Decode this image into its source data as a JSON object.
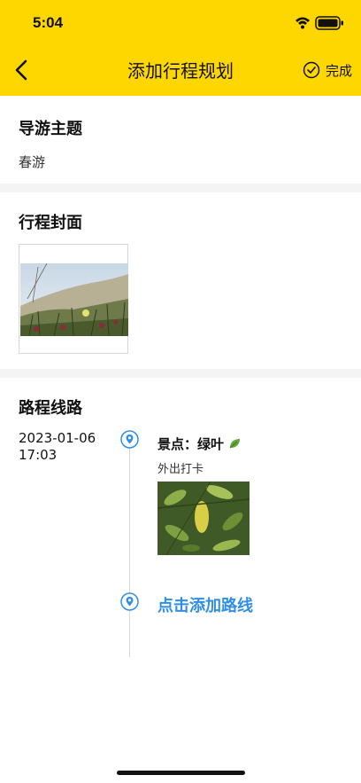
{
  "status_bar": {
    "time": "5:04"
  },
  "nav": {
    "title": "添加行程规划",
    "done_label": "完成"
  },
  "theme_section": {
    "title": "导游主题",
    "value": "春游"
  },
  "cover_section": {
    "title": "行程封面"
  },
  "route_section": {
    "title": "路程线路",
    "stops": [
      {
        "date": "2023-01-06",
        "time": "17:03",
        "spot_title": "景点：绿叶",
        "description": "外出打卡"
      }
    ],
    "add_route_label": "点击添加路线"
  },
  "colors": {
    "header": "#FFD700",
    "accent": "#2F8FE6"
  }
}
